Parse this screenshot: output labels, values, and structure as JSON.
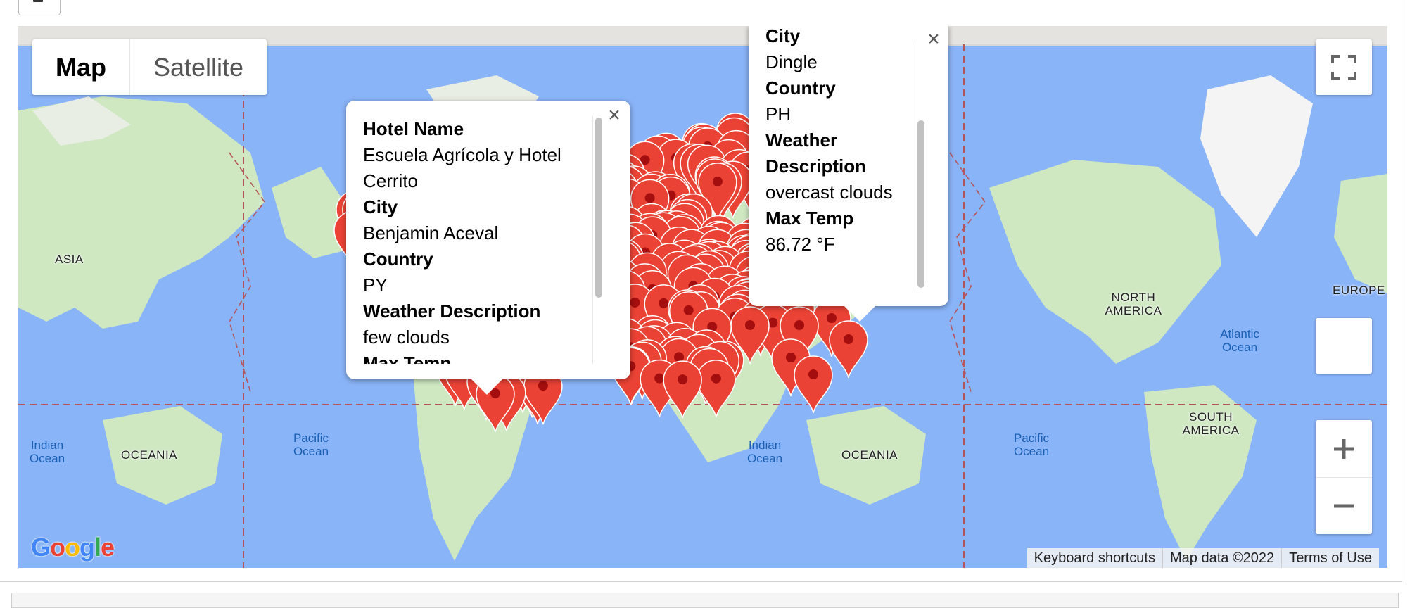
{
  "map": {
    "map_types": [
      {
        "label": "Map",
        "active": true
      },
      {
        "label": "Satellite",
        "active": false
      }
    ],
    "region_labels": [
      "ASIA",
      "OCEANIA",
      "NORTH AMERICA",
      "SOUTH AMERICA",
      "EUROPE",
      "OCEANIA"
    ],
    "ocean_labels": [
      "Indian Ocean",
      "Pacific Ocean",
      "Indian Ocean",
      "Pacific Ocean",
      "Atlantic Ocean"
    ],
    "footer": {
      "keyboard": "Keyboard shortcuts",
      "map_data": "Map data ©2022",
      "terms": "Terms of Use"
    },
    "logo": "Google",
    "colors": {
      "water": "#8ab4f8",
      "land": "#cfe8c2",
      "marker": "#ea4335",
      "marker_dot": "#a50e0e"
    },
    "icons": [
      "fullscreen-icon",
      "zoom-in-icon",
      "zoom-out-icon",
      "close-icon",
      "map-marker-icon"
    ]
  },
  "popup_left": {
    "fields": [
      {
        "label": "Hotel Name",
        "value": "Escuela Agrícola y Hotel Cerrito"
      },
      {
        "label": "City",
        "value": "Benjamin Aceval"
      },
      {
        "label": "Country",
        "value": "PY"
      },
      {
        "label": "Weather Description",
        "value": "few clouds"
      }
    ],
    "cut_off_label": "Max Temp"
  },
  "popup_right": {
    "cut_off_label": "City",
    "fields": [
      {
        "value": "Dingle"
      },
      {
        "label": "Country",
        "value": "PH"
      },
      {
        "label": "Weather Description",
        "value": "overcast clouds"
      },
      {
        "label": "Max Temp",
        "value": "86.72 °F"
      }
    ]
  }
}
